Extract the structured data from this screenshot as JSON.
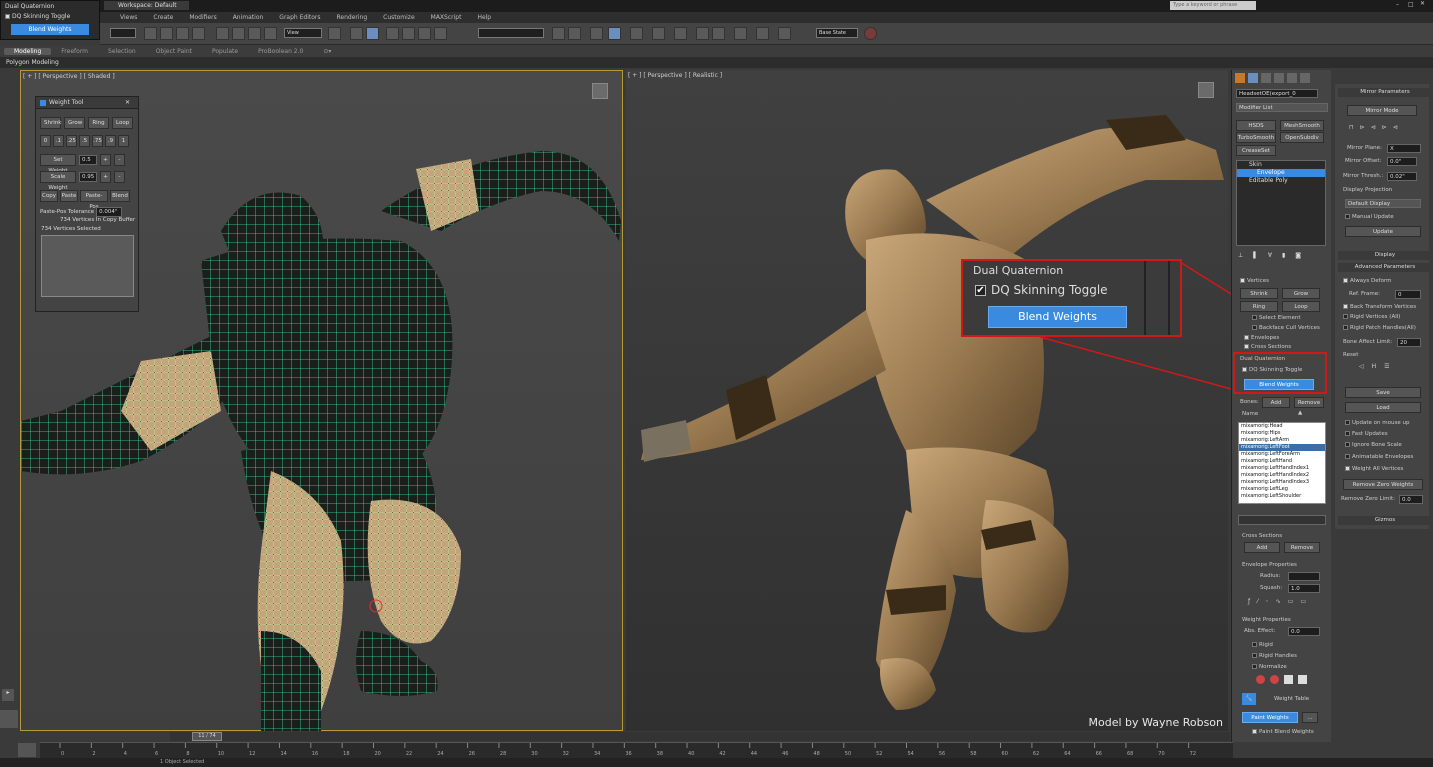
{
  "title_bar": {
    "workspace": "Workspace: Default"
  },
  "top_left": {
    "group": "Dual Quaternion",
    "toggle": "DQ Skinning Toggle",
    "button": "Blend Weights"
  },
  "menu": [
    "Views",
    "Create",
    "Modifiers",
    "Animation",
    "Graph Editors",
    "Rendering",
    "Customize",
    "MAXScript",
    "Help"
  ],
  "toolbar": {
    "view_dropdown": "View",
    "base_state": "Base State",
    "search_placeholder": "Type a keyword or phrase"
  },
  "ribbon": {
    "tabs": [
      "Modeling",
      "Freeform",
      "Selection",
      "Object Paint",
      "Populate",
      "ProBoolean 2.0"
    ],
    "active_tab": "Modeling",
    "sub": "Polygon Modeling"
  },
  "viewports": {
    "left_label": "[ + ] [ Perspective ] [ Shaded ]",
    "right_label": "[ + ] [ Perspective ] [ Realistic ]"
  },
  "weight_tool": {
    "title": "Weight Tool",
    "row1": [
      "Shrink",
      "Grow",
      "Ring",
      "Loop"
    ],
    "row2": [
      "0",
      ".1",
      ".25",
      ".5",
      ".75",
      ".9",
      "1"
    ],
    "set_weight_label": "Set Weight",
    "set_weight_value": "0.5",
    "scale_weight_label": "Scale Weight",
    "scale_weight_value": "0.95",
    "row5": [
      "Copy",
      "Paste",
      "Paste-Pos",
      "Blend"
    ],
    "tolerance_label": "Paste-Pos Tolerance",
    "tolerance_value": "0.004\"",
    "copy_buffer": "734 Vertices In Copy Buffer",
    "selected": "734 Vertices Selected"
  },
  "command_panel": {
    "object_name": "HeadsetOE(export_0",
    "modifier_list": "Modifier List",
    "mod_buttons": [
      "HSDS",
      "MeshSmooth",
      "TurboSmooth",
      "OpenSubdiv",
      "CreaseSet"
    ],
    "stack": [
      {
        "label": "Skin",
        "selected": false
      },
      {
        "label": "Envelope",
        "selected": true
      },
      {
        "label": "Editable Poly",
        "selected": false
      }
    ],
    "select": {
      "vertices": "Vertices",
      "shrink": "Shrink",
      "grow": "Grow",
      "ring": "Ring",
      "loop": "Loop",
      "select_element": "Select Element",
      "backface": "Backface Cull Vertices",
      "envelopes": "Envelopes",
      "cross_sections": "Cross Sections"
    },
    "dq": {
      "group": "Dual Quaternion",
      "toggle": "DQ Skinning Toggle",
      "button": "Blend Weights"
    },
    "bones_label": "Bones:",
    "add": "Add",
    "remove": "Remove",
    "name_label": "Name",
    "bones": [
      {
        "name": "mixamorig:Head",
        "selected": false
      },
      {
        "name": "mixamorig:Hips",
        "selected": false
      },
      {
        "name": "mixamorig:LeftArm",
        "selected": false
      },
      {
        "name": "mixamorig:LeftFoot",
        "selected": true
      },
      {
        "name": "mixamorig:LeftForeArm",
        "selected": false
      },
      {
        "name": "mixamorig:LeftHand",
        "selected": false
      },
      {
        "name": "mixamorig:LeftHandIndex1",
        "selected": false
      },
      {
        "name": "mixamorig:LeftHandIndex2",
        "selected": false
      },
      {
        "name": "mixamorig:LeftHandIndex3",
        "selected": false
      },
      {
        "name": "mixamorig:LeftLeg",
        "selected": false
      },
      {
        "name": "mixamorig:LeftShoulder",
        "selected": false
      }
    ],
    "cross_sections_label": "Cross Sections",
    "envelope_props": "Envelope Properties",
    "radius_label": "Radius:",
    "squash_label": "Squash:",
    "squash_value": "1.0",
    "weight_props": "Weight Properties",
    "abs_effect_label": "Abs. Effect:",
    "abs_effect_value": "0.0",
    "rigid": "Rigid",
    "rigid_handles": "Rigid Handles",
    "normalize": "Normalize",
    "weight_table": "Weight Table",
    "paint_weights": "Paint Weights",
    "more": "...",
    "paint_blend": "Paint Blend Weights"
  },
  "mirror_panel": {
    "title": "Mirror Parameters",
    "mirror_mode": "Mirror Mode",
    "mirror_plane_label": "Mirror Plane:",
    "mirror_plane_value": "X",
    "mirror_offset_label": "Mirror Offset:",
    "mirror_offset_value": "0.0\"",
    "mirror_thresh_label": "Mirror Thresh.:",
    "mirror_thresh_value": "0.02\"",
    "display_projection": "Display Projection",
    "display_value": "Default Display",
    "manual_update": "Manual Update",
    "update": "Update",
    "display_rollout": "Display",
    "advanced_rollout": "Advanced Parameters",
    "always_deform": "Always Deform",
    "ref_frame_label": "Ref. Frame:",
    "ref_frame_value": "0",
    "back_transform": "Back Transform Vertices",
    "rigid_vertices": "Rigid Vertices (All)",
    "rigid_patch": "Rigid Patch Handles(All)",
    "bone_affect_label": "Bone Affect Limit:",
    "bone_affect_value": "20",
    "reset": "Reset",
    "save": "Save",
    "load": "Load",
    "update_mouse": "Update on mouse up",
    "fast_updates": "Fast Updates",
    "ignore_bone_scale": "Ignore Bone Scale",
    "animatable_envelopes": "Animatable Envelopes",
    "weight_all_vertices": "Weight All Vertices",
    "remove_zero": "Remove Zero Weights",
    "remove_zero_limit_label": "Remove Zero Limit:",
    "remove_zero_limit_value": "0.0",
    "gizmos": "Gizmos"
  },
  "callout": {
    "group": "Dual Quaternion",
    "toggle": "DQ Skinning Toggle",
    "button": "Blend Weights"
  },
  "timeline": {
    "frame": "11 / 74",
    "ticks": [
      "0",
      "2",
      "4",
      "6",
      "8",
      "10",
      "12",
      "14",
      "16",
      "18",
      "20",
      "22",
      "24",
      "26",
      "28",
      "30",
      "32",
      "34",
      "36",
      "38",
      "40",
      "42",
      "44",
      "46",
      "48",
      "50",
      "52",
      "54",
      "56",
      "58",
      "60",
      "62",
      "64",
      "66",
      "68",
      "70",
      "72"
    ]
  },
  "status": {
    "text": "1 Object Selected"
  },
  "credit": "Model by Wayne Robson",
  "colors": {
    "accent_blue": "#3a8ae0",
    "callout_red": "#d01818",
    "wire_green": "#3fe0a0"
  }
}
